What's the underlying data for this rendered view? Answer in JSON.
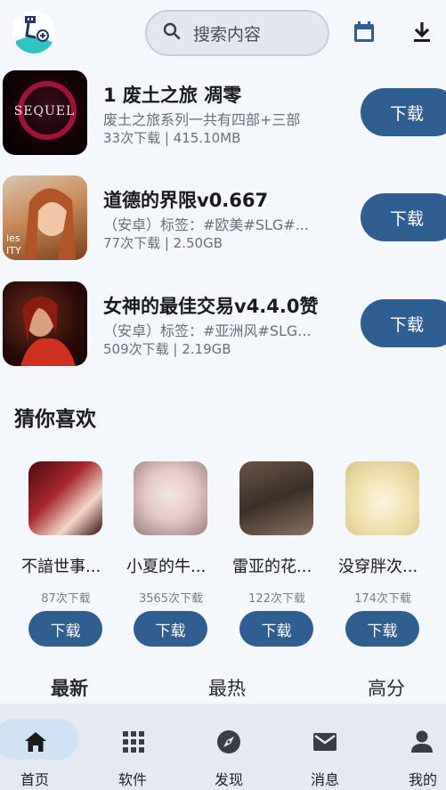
{
  "search": {
    "placeholder": "搜索内容"
  },
  "downloads": [
    {
      "title": "1 废土之旅 凋零",
      "desc": "废土之旅系列一共有四部+三部",
      "meta": "33次下载 | 415.10MB",
      "button": "下载",
      "thumb_text": "SEQUEL"
    },
    {
      "title": "道德的界限v0.667",
      "desc": "（安卓）标签：#欧美#SLG#...",
      "meta": "77次下载 | 2.50GB",
      "button": "下载",
      "thumb_text": "ies\nITY"
    },
    {
      "title": "女神的最佳交易v4.4.0赞",
      "desc": "（安卓）标签：#亚洲风#SLG...",
      "meta": "509次下载 | 2.19GB",
      "button": "下载",
      "thumb_text": ""
    }
  ],
  "recommend": {
    "title": "猜你喜欢",
    "items": [
      {
        "name": "不諳世事...",
        "count": "87次下载",
        "button": "下载"
      },
      {
        "name": "小夏的牛...",
        "count": "3565次下载",
        "button": "下载"
      },
      {
        "name": "雷亚的花...",
        "count": "122次下载",
        "button": "下载"
      },
      {
        "name": "没穿胖次...",
        "count": "174次下载",
        "button": "下载"
      }
    ]
  },
  "tabs": [
    {
      "label": "最新",
      "active": true
    },
    {
      "label": "最热",
      "active": false
    },
    {
      "label": "高分",
      "active": false
    }
  ],
  "nav": [
    {
      "label": "首页",
      "icon": "home-icon",
      "active": true
    },
    {
      "label": "软件",
      "icon": "apps-grid-icon",
      "active": false
    },
    {
      "label": "发现",
      "icon": "compass-icon",
      "active": false
    },
    {
      "label": "消息",
      "icon": "mail-icon",
      "active": false
    },
    {
      "label": "我的",
      "icon": "person-icon",
      "active": false
    }
  ],
  "colors": {
    "accent": "#2f5f91",
    "nav_bg": "#e4e9f2",
    "nav_active": "#d2e2f5",
    "background": "#f4f7fc"
  }
}
